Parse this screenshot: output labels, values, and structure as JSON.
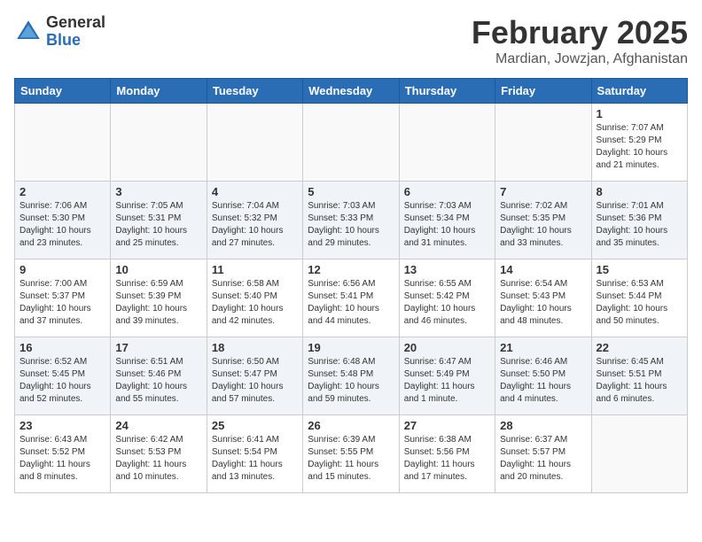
{
  "header": {
    "logo_general": "General",
    "logo_blue": "Blue",
    "month_title": "February 2025",
    "location": "Mardian, Jowzjan, Afghanistan"
  },
  "days_of_week": [
    "Sunday",
    "Monday",
    "Tuesday",
    "Wednesday",
    "Thursday",
    "Friday",
    "Saturday"
  ],
  "weeks": [
    [
      {
        "day": "",
        "info": ""
      },
      {
        "day": "",
        "info": ""
      },
      {
        "day": "",
        "info": ""
      },
      {
        "day": "",
        "info": ""
      },
      {
        "day": "",
        "info": ""
      },
      {
        "day": "",
        "info": ""
      },
      {
        "day": "1",
        "info": "Sunrise: 7:07 AM\nSunset: 5:29 PM\nDaylight: 10 hours and 21 minutes."
      }
    ],
    [
      {
        "day": "2",
        "info": "Sunrise: 7:06 AM\nSunset: 5:30 PM\nDaylight: 10 hours and 23 minutes."
      },
      {
        "day": "3",
        "info": "Sunrise: 7:05 AM\nSunset: 5:31 PM\nDaylight: 10 hours and 25 minutes."
      },
      {
        "day": "4",
        "info": "Sunrise: 7:04 AM\nSunset: 5:32 PM\nDaylight: 10 hours and 27 minutes."
      },
      {
        "day": "5",
        "info": "Sunrise: 7:03 AM\nSunset: 5:33 PM\nDaylight: 10 hours and 29 minutes."
      },
      {
        "day": "6",
        "info": "Sunrise: 7:03 AM\nSunset: 5:34 PM\nDaylight: 10 hours and 31 minutes."
      },
      {
        "day": "7",
        "info": "Sunrise: 7:02 AM\nSunset: 5:35 PM\nDaylight: 10 hours and 33 minutes."
      },
      {
        "day": "8",
        "info": "Sunrise: 7:01 AM\nSunset: 5:36 PM\nDaylight: 10 hours and 35 minutes."
      }
    ],
    [
      {
        "day": "9",
        "info": "Sunrise: 7:00 AM\nSunset: 5:37 PM\nDaylight: 10 hours and 37 minutes."
      },
      {
        "day": "10",
        "info": "Sunrise: 6:59 AM\nSunset: 5:39 PM\nDaylight: 10 hours and 39 minutes."
      },
      {
        "day": "11",
        "info": "Sunrise: 6:58 AM\nSunset: 5:40 PM\nDaylight: 10 hours and 42 minutes."
      },
      {
        "day": "12",
        "info": "Sunrise: 6:56 AM\nSunset: 5:41 PM\nDaylight: 10 hours and 44 minutes."
      },
      {
        "day": "13",
        "info": "Sunrise: 6:55 AM\nSunset: 5:42 PM\nDaylight: 10 hours and 46 minutes."
      },
      {
        "day": "14",
        "info": "Sunrise: 6:54 AM\nSunset: 5:43 PM\nDaylight: 10 hours and 48 minutes."
      },
      {
        "day": "15",
        "info": "Sunrise: 6:53 AM\nSunset: 5:44 PM\nDaylight: 10 hours and 50 minutes."
      }
    ],
    [
      {
        "day": "16",
        "info": "Sunrise: 6:52 AM\nSunset: 5:45 PM\nDaylight: 10 hours and 52 minutes."
      },
      {
        "day": "17",
        "info": "Sunrise: 6:51 AM\nSunset: 5:46 PM\nDaylight: 10 hours and 55 minutes."
      },
      {
        "day": "18",
        "info": "Sunrise: 6:50 AM\nSunset: 5:47 PM\nDaylight: 10 hours and 57 minutes."
      },
      {
        "day": "19",
        "info": "Sunrise: 6:48 AM\nSunset: 5:48 PM\nDaylight: 10 hours and 59 minutes."
      },
      {
        "day": "20",
        "info": "Sunrise: 6:47 AM\nSunset: 5:49 PM\nDaylight: 11 hours and 1 minute."
      },
      {
        "day": "21",
        "info": "Sunrise: 6:46 AM\nSunset: 5:50 PM\nDaylight: 11 hours and 4 minutes."
      },
      {
        "day": "22",
        "info": "Sunrise: 6:45 AM\nSunset: 5:51 PM\nDaylight: 11 hours and 6 minutes."
      }
    ],
    [
      {
        "day": "23",
        "info": "Sunrise: 6:43 AM\nSunset: 5:52 PM\nDaylight: 11 hours and 8 minutes."
      },
      {
        "day": "24",
        "info": "Sunrise: 6:42 AM\nSunset: 5:53 PM\nDaylight: 11 hours and 10 minutes."
      },
      {
        "day": "25",
        "info": "Sunrise: 6:41 AM\nSunset: 5:54 PM\nDaylight: 11 hours and 13 minutes."
      },
      {
        "day": "26",
        "info": "Sunrise: 6:39 AM\nSunset: 5:55 PM\nDaylight: 11 hours and 15 minutes."
      },
      {
        "day": "27",
        "info": "Sunrise: 6:38 AM\nSunset: 5:56 PM\nDaylight: 11 hours and 17 minutes."
      },
      {
        "day": "28",
        "info": "Sunrise: 6:37 AM\nSunset: 5:57 PM\nDaylight: 11 hours and 20 minutes."
      },
      {
        "day": "",
        "info": ""
      }
    ]
  ]
}
